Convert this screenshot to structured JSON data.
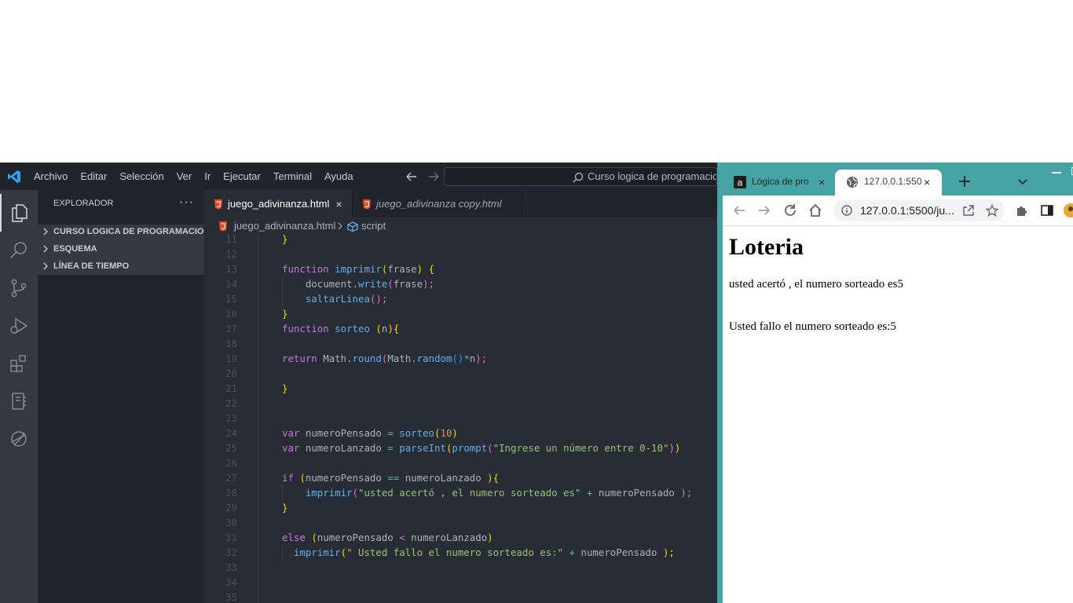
{
  "vscode": {
    "menu": [
      "Archivo",
      "Editar",
      "Selección",
      "Ver",
      "Ir",
      "Ejecutar",
      "Terminal",
      "Ayuda"
    ],
    "search_text": "Curso logica de programacion",
    "sidebar": {
      "title": "EXPLORADOR",
      "more": "···",
      "sections": [
        "CURSO LOGICA DE PROGRAMACION",
        "ESQUEMA",
        "LÍNEA DE TIEMPO"
      ]
    },
    "tabs": [
      {
        "label": "juego_adivinanza.html",
        "close": "×"
      },
      {
        "label": "juego_adivinanza copy.html"
      }
    ],
    "breadcrumb": {
      "file": "juego_adivinanza.html",
      "symbol": "script"
    },
    "line_numbers": [
      "11",
      "12",
      "13",
      "14",
      "15",
      "16",
      "17",
      "18",
      "19",
      "20",
      "21",
      "22",
      "23",
      "24",
      "25",
      "26",
      "27",
      "28",
      "29",
      "30",
      "31",
      "32",
      "33",
      "34",
      "35"
    ],
    "code": {
      "l11": "}",
      "l13_kw": "function",
      "l13_fn": "imprimir",
      "l13_p": "(",
      "l13_arg": "frase",
      "l13_p2": ")",
      "l13_b": "{",
      "l14_a": "document.",
      "l14_fn": "write",
      "l14_p": "(",
      "l14_arg": "frase",
      "l14_p2": ");",
      "l15_fn": "saltarLinea",
      "l15_p": "();",
      "l16": "}",
      "l17_kw": "function",
      "l17_fn": "sorteo",
      "l17_p": "(",
      "l17_arg": "n",
      "l17_p2": ")",
      "l17_b": "{",
      "l19_kw": "return",
      "l19_a": "Math.",
      "l19_fn": "round",
      "l19_p": "(",
      "l19_b": "Math.",
      "l19_fn2": "random",
      "l19_p2": "()",
      "l19_op": "*",
      "l19_c": "n",
      "l19_p3": ");",
      "l21": "}",
      "l24_kw": "var",
      "l24_a": "numeroPensado",
      "l24_op": "=",
      "l24_fn": "sorteo",
      "l24_p": "(",
      "l24_n": "10",
      "l24_p2": ")",
      "l25_kw": "var",
      "l25_a": "numeroLanzado",
      "l25_op": "=",
      "l25_fn": "parseInt",
      "l25_p": "(",
      "l25_fn2": "prompt",
      "l25_p2": "(",
      "l25_s": "\"Ingrese un número entre 0-10\"",
      "l25_p3": ")",
      "l25_p4": ")",
      "l27_kw": "if",
      "l27_p": "(",
      "l27_a": "numeroPensado",
      "l27_op": "==",
      "l27_b": "numeroLanzado",
      "l27_p2": ")",
      "l27_c": "{",
      "l28_fn": "imprimir",
      "l28_p": "(",
      "l28_s": "\"usted acertó , el numero sorteado es\"",
      "l28_op": "+",
      "l28_a": "numeroPensado",
      "l28_p2": ");",
      "l29": "}",
      "l31_kw": "else",
      "l31_p": "(",
      "l31_a": "numeroPensado",
      "l31_op": "<",
      "l31_b": "numeroLanzado",
      "l31_p2": ")",
      "l32_fn": "imprimir",
      "l32_p": "(",
      "l32_s": "\" Usted fallo el numero sorteado es:\"",
      "l32_op": "+",
      "l32_a": "numeroPensado",
      "l32_p2": ");"
    }
  },
  "browser": {
    "tabs": [
      {
        "title": "Lógica de pro",
        "close": "×"
      },
      {
        "title": "127.0.0.1:550",
        "close": "×"
      }
    ],
    "address": "127.0.0.1:5500/ju...",
    "page": {
      "heading": "Loteria",
      "lines": [
        "usted acertó , el numero sorteado es5",
        "Usted fallo el numero sorteado es:5"
      ]
    }
  },
  "colors": {
    "vscode_bg": "#282c34",
    "sidebar_bg": "#21252b",
    "chrome_frame": "#46a4a4"
  }
}
